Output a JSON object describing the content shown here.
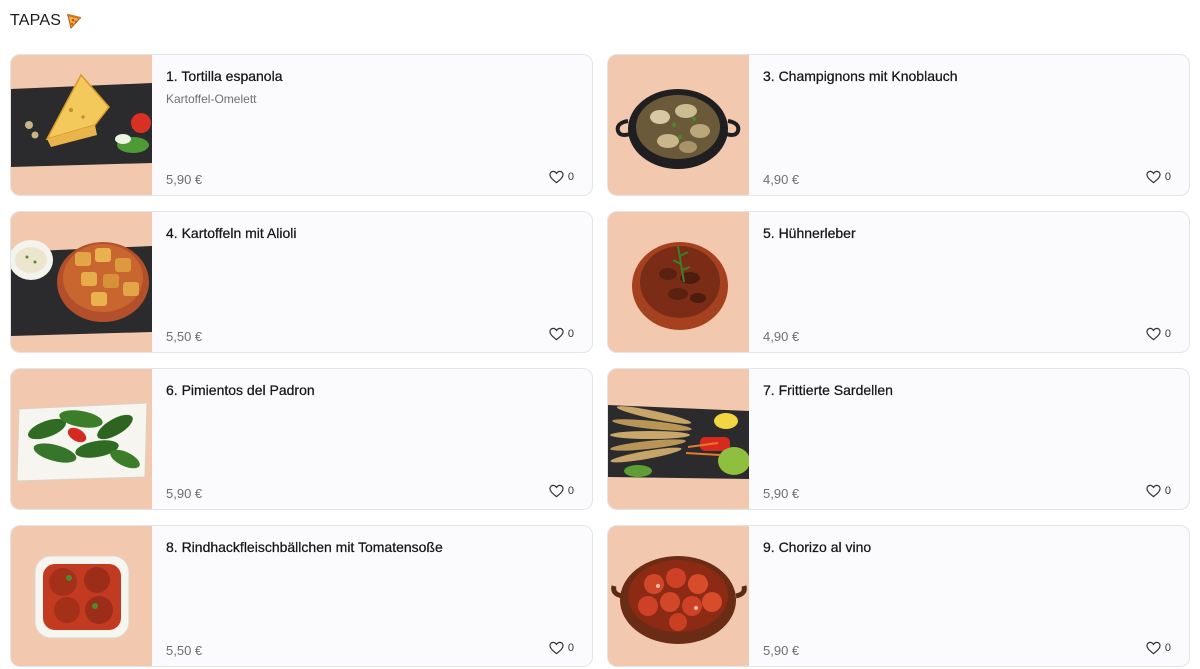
{
  "section": {
    "title": "TAPAS",
    "icon": "pizza-slice-icon"
  },
  "colors": {
    "card_bg": "#fbfbfd",
    "card_border": "#e3e4ea",
    "thumb_bg": "#f1c8ad",
    "price": "#6e6e74"
  },
  "items": [
    {
      "title": "1. Tortilla espanola",
      "description": "Kartoffel-Omelett",
      "price": "5,90 €",
      "likes": "0",
      "image": "tortilla-photo"
    },
    {
      "title": "3. Champignons mit Knoblauch",
      "description": "",
      "price": "4,90 €",
      "likes": "0",
      "image": "mushrooms-pan-photo"
    },
    {
      "title": "4. Kartoffeln mit Alioli",
      "description": "",
      "price": "5,50 €",
      "likes": "0",
      "image": "potatoes-alioli-photo"
    },
    {
      "title": "5. Hühnerleber",
      "description": "",
      "price": "4,90 €",
      "likes": "0",
      "image": "chicken-liver-bowl-photo"
    },
    {
      "title": "6. Pimientos del Padron",
      "description": "",
      "price": "5,90 €",
      "likes": "0",
      "image": "padron-peppers-photo"
    },
    {
      "title": "7. Frittierte Sardellen",
      "description": "",
      "price": "5,90 €",
      "likes": "0",
      "image": "fried-anchovies-photo"
    },
    {
      "title": "8. Rindhackfleischbällchen mit Tomatensoße",
      "description": "",
      "price": "5,50 €",
      "likes": "0",
      "image": "meatballs-tomato-photo"
    },
    {
      "title": "9. Chorizo al vino",
      "description": "",
      "price": "5,90 €",
      "likes": "0",
      "image": "chorizo-wine-photo"
    }
  ]
}
